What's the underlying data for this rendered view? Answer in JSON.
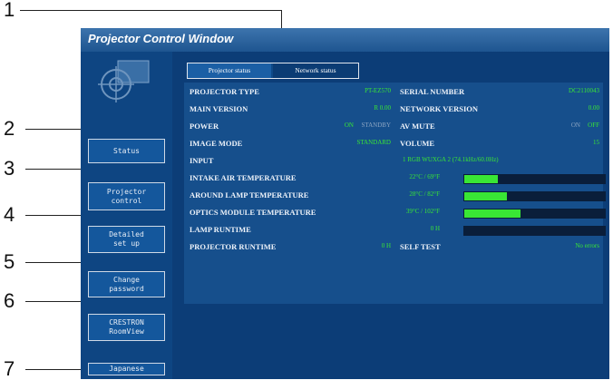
{
  "callouts": [
    "1",
    "2",
    "3",
    "4",
    "5",
    "6",
    "7"
  ],
  "window": {
    "title": "Projector Control Window"
  },
  "sidebar": {
    "buttons": [
      {
        "label": "Status"
      },
      {
        "label": "Projector\ncontrol"
      },
      {
        "label": "Detailed\nset up"
      },
      {
        "label": "Change\npassword"
      },
      {
        "label": "CRESTRON\nRoomView"
      },
      {
        "label": "Japanese"
      }
    ]
  },
  "tabs": [
    {
      "label": "Projector status",
      "active": true
    },
    {
      "label": "Network status",
      "active": false
    }
  ],
  "status": {
    "projector_type_label": "PROJECTOR TYPE",
    "projector_type": "PT-EZ570",
    "serial_label": "SERIAL NUMBER",
    "serial": "DC2110043",
    "main_version_label": "MAIN VERSION",
    "main_version": "R 0.00",
    "network_version_label": "NETWORK VERSION",
    "network_version": "0.00",
    "power_label": "POWER",
    "power_on": "ON",
    "power_standby": "STANDBY",
    "av_mute_label": "AV MUTE",
    "av_mute_on": "ON",
    "av_mute_off": "OFF",
    "image_mode_label": "IMAGE MODE",
    "image_mode": "STANDARD",
    "volume_label": "VOLUME",
    "volume": "15",
    "input_label": "INPUT",
    "input": "1 RGB    WUXGA 2 (74.1kHz/60.0Hz)",
    "intake_label": "INTAKE AIR TEMPERATURE",
    "intake": "22°C / 69°F",
    "intake_level": 0.24,
    "lamp_temp_label": "AROUND LAMP TEMPERATURE",
    "lamp_temp": "28°C / 82°F",
    "lamp_temp_level": 0.3,
    "optics_label": "OPTICS MODULE TEMPERATURE",
    "optics": "39°C / 102°F",
    "optics_level": 0.4,
    "lamp_runtime_label": "LAMP RUNTIME",
    "lamp_runtime": "0 H",
    "lamp_runtime_level": 0,
    "projector_runtime_label": "PROJECTOR RUNTIME",
    "projector_runtime": "0 H",
    "self_test_label": "SELF TEST",
    "self_test": "No errors"
  },
  "colors": {
    "value_green": "#39e635",
    "window_blue": "#0d3f7a"
  }
}
